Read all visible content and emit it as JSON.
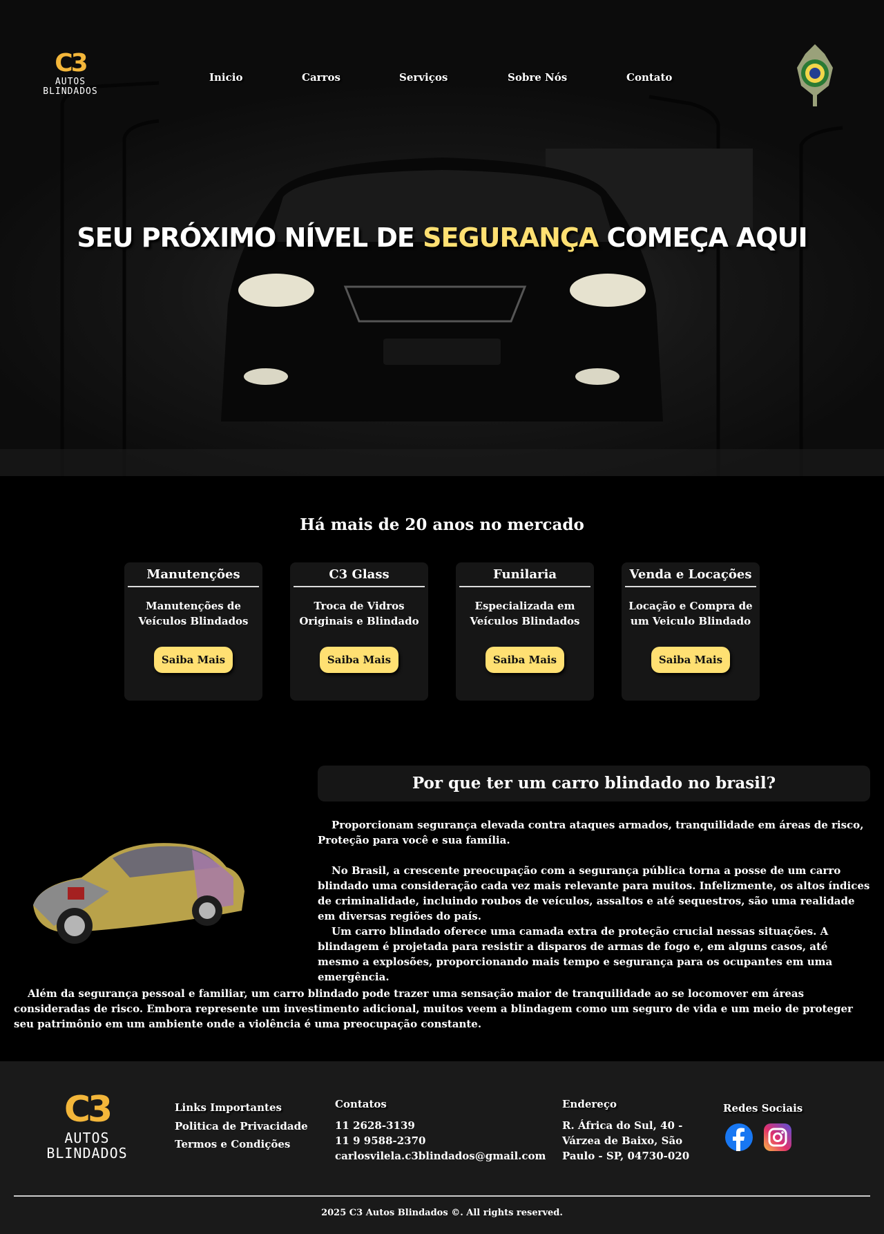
{
  "brand": {
    "mark": "C3",
    "name": "AUTOS BLINDADOS"
  },
  "nav": {
    "items": [
      {
        "label": "Inicio"
      },
      {
        "label": "Carros"
      },
      {
        "label": "Serviços"
      },
      {
        "label": "Sobre Nós"
      },
      {
        "label": "Contato"
      }
    ]
  },
  "hero": {
    "title_before": "SEU PRÓXIMO NÍVEL DE ",
    "title_highlight": "SEGURANÇA",
    "title_after": " COMEÇA AQUI"
  },
  "services": {
    "heading": "Há mais de 20 anos no mercado",
    "cards": [
      {
        "title": "Manutenções",
        "description": "Manutenções de Veículos Blindados",
        "button": "Saiba Mais"
      },
      {
        "title": "C3 Glass",
        "description": "Troca de Vidros Originais e Blindado",
        "button": "Saiba Mais"
      },
      {
        "title": "Funilaria",
        "description": "Especializada em Veículos Blindados",
        "button": "Saiba Mais"
      },
      {
        "title": "Venda e Locações",
        "description": "Locação e Compra de um Veiculo Blindado",
        "button": "Saiba Mais"
      }
    ]
  },
  "why": {
    "heading": "Por que ter um carro blindado no brasil?",
    "paragraphs": [
      "Proporcionam segurança elevada contra ataques armados, tranquilidade em áreas de risco, Proteção para você e sua família.",
      "No Brasil, a crescente preocupação com a segurança pública torna a posse de um carro blindado uma consideração cada vez mais relevante para muitos. Infelizmente, os altos índices de criminalidade, incluindo roubos de veículos, assaltos e até sequestros, são uma realidade em diversas regiões do país.",
      "Um carro blindado oferece uma camada extra de proteção crucial nessas situações. A blindagem é projetada para resistir a disparos de armas de fogo e, em alguns casos, até mesmo a explosões, proporcionando mais tempo e segurança para os ocupantes em uma emergência.",
      "Além da segurança pessoal e familiar, um carro blindado pode trazer uma sensação maior de tranquilidade ao se locomover em áreas consideradas de risco. Embora represente um investimento adicional, muitos veem a blindagem como um seguro de vida e um meio de proteger seu patrimônio em um ambiente onde a violência é uma preocupação constante."
    ]
  },
  "footer": {
    "links": {
      "heading": "Links Importantes",
      "items": [
        "Politica de Privacidade",
        "Termos e Condições"
      ]
    },
    "contacts": {
      "heading": "Contatos",
      "items": [
        "11 2628-3139",
        "11 9 9588-2370",
        "carlosvilela.c3blindados@gmail.com"
      ]
    },
    "address": {
      "heading": "Endereço",
      "lines": [
        "R. África do Sul, 40 -",
        "Várzea de Baixo, São",
        "Paulo - SP, 04730-020"
      ]
    },
    "social": {
      "heading": "Redes Sociais",
      "icons": [
        "facebook-icon",
        "instagram-icon"
      ]
    },
    "copyright": "2025 C3 Autos Blindados ©. All rights reserved."
  },
  "colors": {
    "accent": "#ffe072",
    "brand_orange": "#f3b63a",
    "card_bg": "#161616",
    "footer_bg": "#1a1a1a",
    "page_bg": "#000000"
  }
}
